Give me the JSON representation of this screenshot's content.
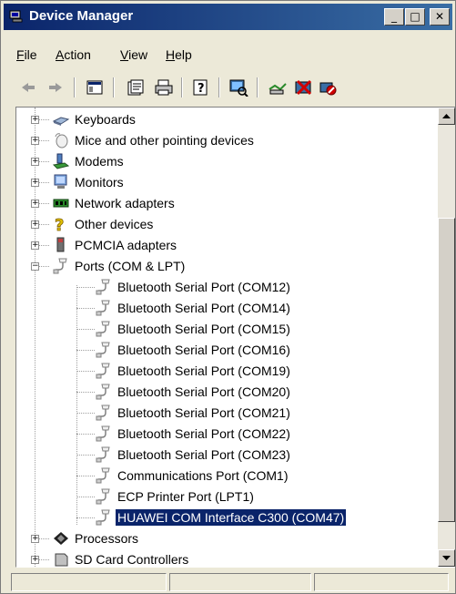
{
  "window": {
    "title": "Device Manager",
    "controls": {
      "minimize": "_",
      "maximize": "□",
      "close": "✕"
    }
  },
  "menubar": {
    "items": [
      {
        "label": "File",
        "accel": "F",
        "rest": "ile"
      },
      {
        "label": "Action",
        "accel": "A",
        "rest": "ction"
      },
      {
        "label": "View",
        "accel": "V",
        "rest": "iew"
      },
      {
        "label": "Help",
        "accel": "H",
        "rest": "elp"
      }
    ]
  },
  "toolbar": {
    "buttons": [
      "back-icon",
      "forward-icon",
      "show-hide-tree-icon",
      "properties-icon",
      "print-icon",
      "help-icon",
      "scan-hardware-icon",
      "update-driver-icon",
      "uninstall-icon",
      "disable-icon"
    ]
  },
  "tree": {
    "categories": [
      {
        "label": "Keyboards",
        "icon": "keyboard-icon"
      },
      {
        "label": "Mice and other pointing devices",
        "icon": "mouse-icon"
      },
      {
        "label": "Modems",
        "icon": "modem-icon"
      },
      {
        "label": "Monitors",
        "icon": "monitor-icon"
      },
      {
        "label": "Network adapters",
        "icon": "network-adapter-icon"
      },
      {
        "label": "Other devices",
        "icon": "unknown-device-icon"
      },
      {
        "label": "PCMCIA adapters",
        "icon": "pcmcia-icon"
      },
      {
        "label": "Ports (COM & LPT)",
        "icon": "port-icon",
        "expanded": true
      }
    ],
    "ports": [
      "Bluetooth Serial Port (COM12)",
      "Bluetooth Serial Port (COM14)",
      "Bluetooth Serial Port (COM15)",
      "Bluetooth Serial Port (COM16)",
      "Bluetooth Serial Port (COM19)",
      "Bluetooth Serial Port (COM20)",
      "Bluetooth Serial Port (COM21)",
      "Bluetooth Serial Port (COM22)",
      "Bluetooth Serial Port (COM23)",
      "Communications Port (COM1)",
      "ECP Printer Port (LPT1)",
      "HUAWEI COM Interface C300 (COM47)"
    ],
    "selected": "HUAWEI COM Interface C300 (COM47)",
    "after": [
      {
        "label": "Processors",
        "icon": "processor-icon"
      },
      {
        "label": "SD Card Controllers",
        "icon": "sd-card-icon"
      }
    ]
  },
  "colors": {
    "selection": "#0a246a",
    "title_start": "#0a246a",
    "title_end": "#3a6ea5"
  }
}
